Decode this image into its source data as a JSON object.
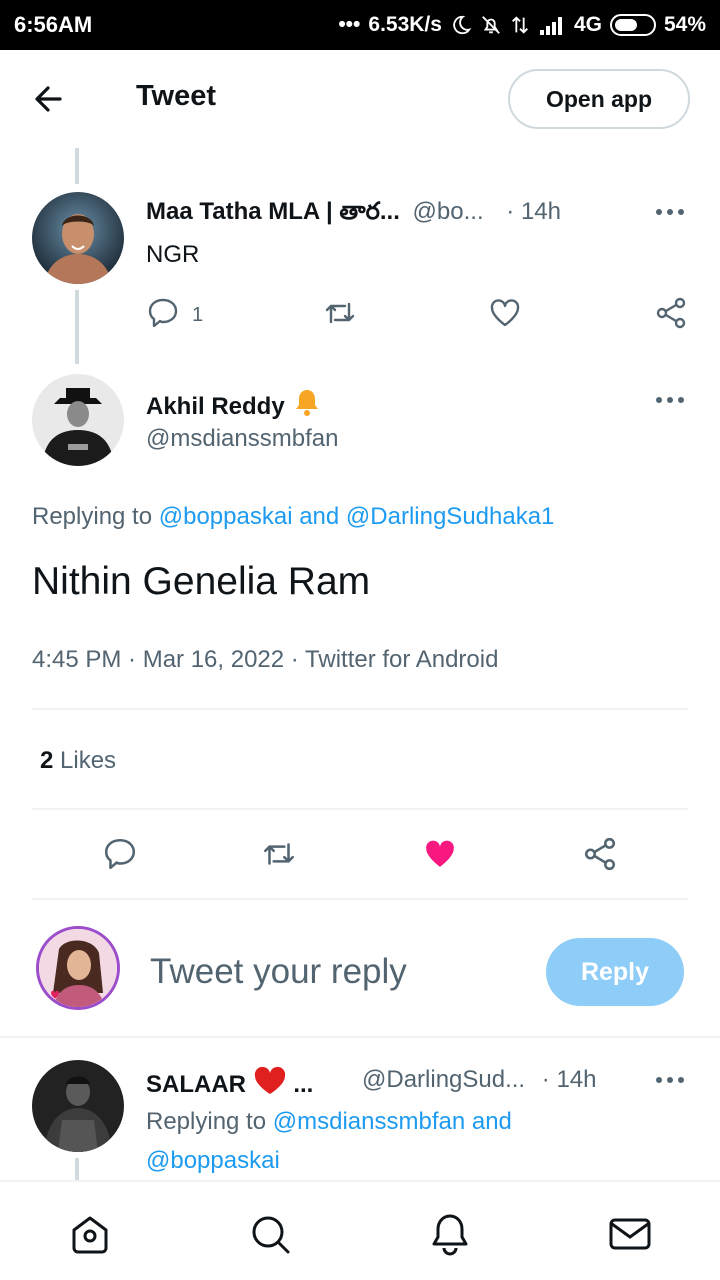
{
  "status_bar": {
    "time": "6:56AM",
    "speed": "6.53K/s",
    "network": "4G",
    "battery": "54%"
  },
  "header": {
    "title": "Tweet",
    "open_app_label": "Open app"
  },
  "parent_tweet": {
    "name": "Maa Tatha MLA | తార...",
    "handle": "@bo...",
    "time": "· 14h",
    "text": "NGR",
    "reply_count": "1"
  },
  "main_tweet": {
    "name": "Akhil Reddy",
    "handle": "@msdianssmbfan",
    "replying_prefix": "Replying to",
    "replying_users": "@boppaskai and @DarlingSudhaka1",
    "text": "Nithin Genelia Ram",
    "meta": "4:45 PM · Mar 16, 2022 · Twitter for Android",
    "likes_count": "2",
    "likes_label": "Likes"
  },
  "composer": {
    "placeholder": "Tweet your reply",
    "reply_label": "Reply"
  },
  "reply_tweet": {
    "name": "SALAAR",
    "ellipsis": "...",
    "handle": "@DarlingSud...",
    "time": "· 14h",
    "replying_prefix": "Replying to",
    "replying_users_line1": "@msdianssmbfan and",
    "replying_users_line2": "@boppaskai"
  },
  "colors": {
    "accent": "#1d9bf0",
    "like_active": "#f91880",
    "reply_button": "#8ecdf8",
    "muted": "#536471"
  }
}
